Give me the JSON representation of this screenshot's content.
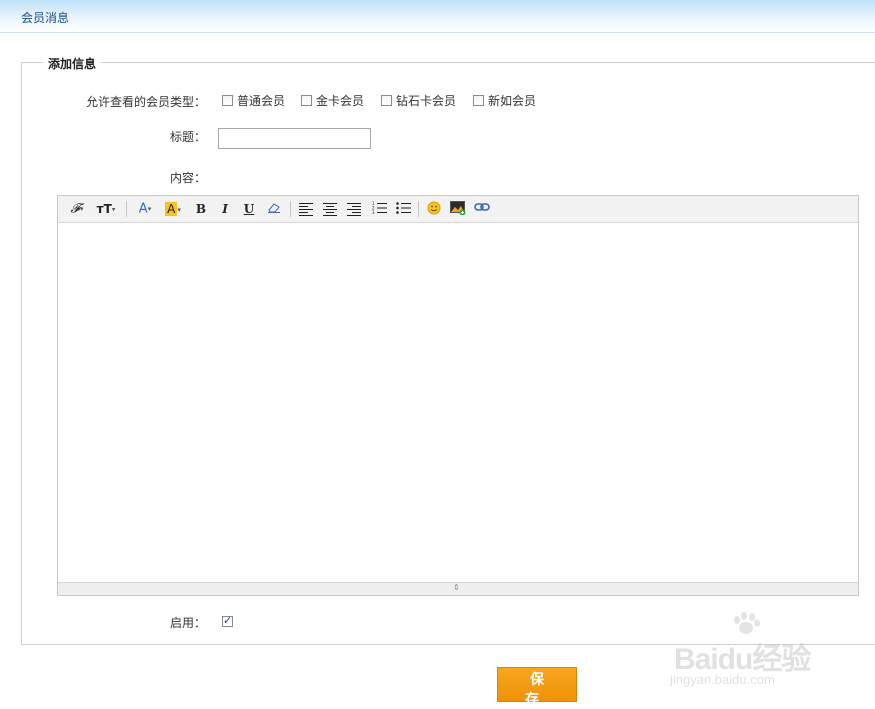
{
  "header": {
    "title": "会员消息"
  },
  "form": {
    "legend": "添加信息",
    "member_type_label": "允许查看的会员类型：",
    "member_types": [
      {
        "label": "普通会员",
        "checked": false
      },
      {
        "label": "金卡会员",
        "checked": false
      },
      {
        "label": "钻石卡会员",
        "checked": false
      },
      {
        "label": "新如会员",
        "checked": false
      }
    ],
    "title_label": "标题：",
    "title_value": "",
    "content_label": "内容：",
    "enable_label": "启用：",
    "enable_checked": true,
    "save_label": "保 存"
  },
  "editor": {
    "toolbar": {
      "font_family": "𝓕",
      "font_size": "тT",
      "font_color": "A",
      "highlight": "A",
      "bold": "B",
      "italic": "I",
      "underline": "U"
    },
    "icons": [
      "font-family-icon",
      "font-size-icon",
      "font-color-icon",
      "highlight-icon",
      "bold-icon",
      "italic-icon",
      "underline-icon",
      "eraser-icon",
      "align-left-icon",
      "align-center-icon",
      "align-right-icon",
      "ordered-list-icon",
      "unordered-list-icon",
      "emoticon-icon",
      "image-icon",
      "link-icon"
    ]
  },
  "watermark": {
    "logo": "Baidu经验",
    "url": "jingyan.baidu.com"
  },
  "colors": {
    "accent": "#f39c12",
    "header_gradient": "#bfe0fa",
    "link_blue": "#1c4f86"
  }
}
